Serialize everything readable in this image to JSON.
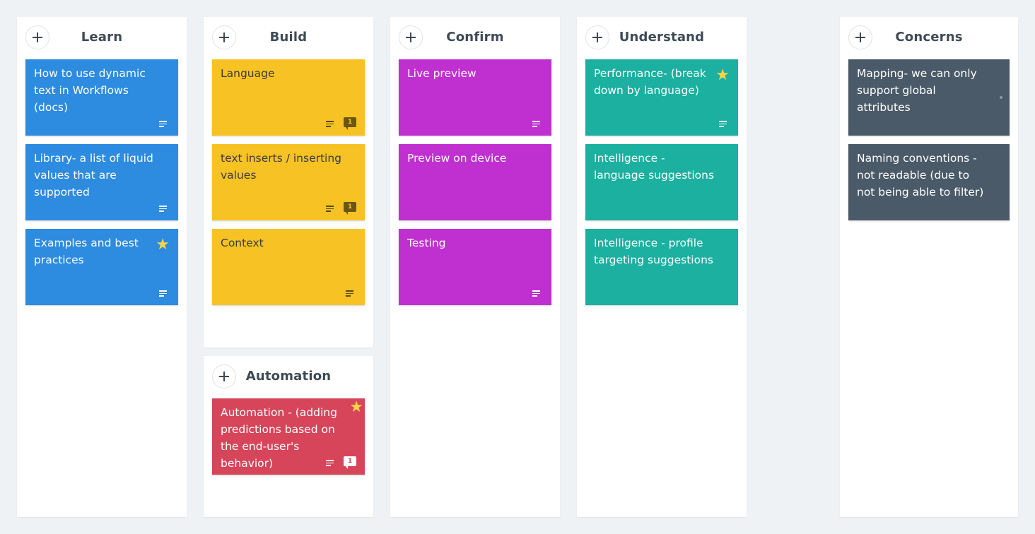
{
  "columns": {
    "learn": {
      "title": "Learn",
      "cards": [
        {
          "text": "How to use dynamic text in Workflows (docs)"
        },
        {
          "text": "Library- a list of liquid values that are supported"
        },
        {
          "text": "Examples and best practices"
        }
      ]
    },
    "build": {
      "title": "Build",
      "cards": [
        {
          "text": "Language",
          "comments": "1"
        },
        {
          "text": "text inserts / inserting values",
          "comments": "1"
        },
        {
          "text": "Context"
        }
      ]
    },
    "automation": {
      "title": "Automation",
      "cards": [
        {
          "text": "Automation - (adding predictions based on the end-user's behavior)",
          "comments": "1"
        }
      ]
    },
    "confirm": {
      "title": "Confirm",
      "cards": [
        {
          "text": "Live preview"
        },
        {
          "text": "Preview on device"
        },
        {
          "text": "Testing"
        }
      ]
    },
    "understand": {
      "title": "Understand",
      "cards": [
        {
          "text": "Performance- (break down by language)"
        },
        {
          "text": "Intelligence - language suggestions"
        },
        {
          "text": "Intelligence - profile targeting suggestions"
        }
      ]
    },
    "concerns": {
      "title": "Concerns",
      "cards": [
        {
          "text": "Mapping- we can only support global attributes"
        },
        {
          "text": "Naming conventions - not readable (due to not being able to filter)"
        }
      ]
    }
  },
  "icons": {
    "add": "plus-icon",
    "star": "star-icon",
    "description": "description-lines-icon",
    "comment": "comment-icon"
  },
  "colors": {
    "background": "#eef2f5",
    "learn": "#2d8be0",
    "build": "#f7c224",
    "confirm": "#c030d0",
    "understand": "#1bb0a0",
    "automation": "#d6455a",
    "concerns": "#4b5a68",
    "star": "#f8d54b"
  }
}
